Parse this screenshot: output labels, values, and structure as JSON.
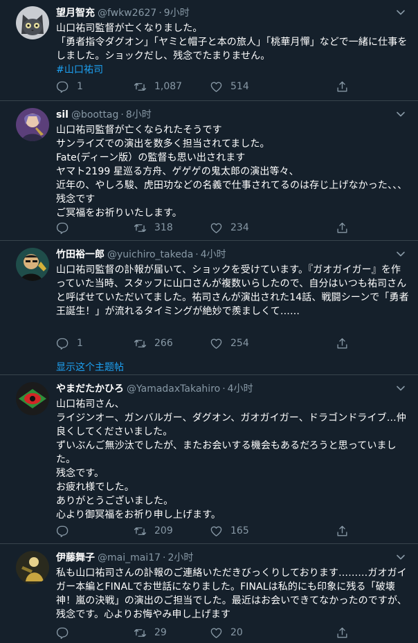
{
  "tweets": [
    {
      "name": "望月智充",
      "handle": "@fwkw2627",
      "dot": "·",
      "time": "9小时",
      "avatar": "cat-avatar",
      "lines": [
        "山口祐司監督が亡くなりました。",
        "「勇者指令ダグオン」「ヤミと帽子と本の旅人」「桃華月憚」などで一緒に仕事をしました。ショックだし、残念でたまりません。"
      ],
      "hashtag": "#山口祐司",
      "reply_count": "1",
      "retweet_count": "1,087",
      "like_count": "514"
    },
    {
      "name": "sil",
      "handle": "@boottag",
      "dot": "·",
      "time": "8小时",
      "avatar": "anime-avatar",
      "text": "山口祐司監督が亡くなられたそうです\nサンライズでの演出を数多く担当されてました。\nFate(ディーン版）の監督も思い出されます\nヤマト2199 星巡る方舟、ゲゲゲの鬼太郎の演出等々、\n近年の、やしろ駿、虎田功などの名義で仕事されてるのは存じ上げなかった、、、残念です\nご冥福をお祈りいたします。",
      "reply_count": "",
      "retweet_count": "318",
      "like_count": "234"
    },
    {
      "name": "竹田裕一郎",
      "handle": "@yuichiro_takeda",
      "dot": "·",
      "time": "4小时",
      "avatar": "portrait-avatar",
      "text": "山口祐司監督の訃報が届いて、ショックを受けています。『ガオガイガー』を作っていた当時、スタッフに山口さんが複数いらしたので、自分はいつも祐司さんと呼ばせていただいてました。祐司さんが演出された14話、戦闘シーンで「勇者王誕生！」が流れるタイミングが絶妙で羨ましくて……",
      "reply_count": "1",
      "retweet_count": "266",
      "like_count": "254",
      "thread_link": "显示这个主题帖"
    },
    {
      "name": "やまだたかひろ",
      "handle": "@YamadaxTakahiro",
      "dot": "·",
      "time": "4小时",
      "avatar": "eye-avatar",
      "text": "山口祐司さん、\nライジンオー、ガンバルガー、ダグオン、ガオガイガー、ドラゴンドライブ…仲良くしてくださいました。\nずいぶんご無沙汰でしたが、またお会いする機会もあるだろうと思っていました。\n残念です。\nお疲れ様でした。\nありがとうございました。\n心より御冥福をお祈り申し上げます。",
      "reply_count": "",
      "retweet_count": "209",
      "like_count": "165"
    },
    {
      "name": "伊藤舞子",
      "handle": "@mai_mai17",
      "dot": "·",
      "time": "2小时",
      "avatar": "figure-avatar",
      "text": "私も山口祐司さんの訃報のご連絡いただきびっくりしております………ガオガイガー本編とFINALでお世話になりました。FINALは私的にも印象に残る「破壊神！嵐の決戦」の演出のご担当でした。最近はお会いできてなかったのですが、残念です。心よりお悔やみ申し上げます",
      "reply_count": "",
      "retweet_count": "29",
      "like_count": "20"
    }
  ],
  "colors": {
    "background": "#15202b",
    "secondary_text": "#8899a6",
    "accent": "#1da1f2",
    "divider": "#38444d"
  },
  "icons": {
    "reply": "reply-icon",
    "retweet": "retweet-icon",
    "like": "like-icon",
    "share": "share-icon",
    "more": "chevron-down-icon"
  }
}
